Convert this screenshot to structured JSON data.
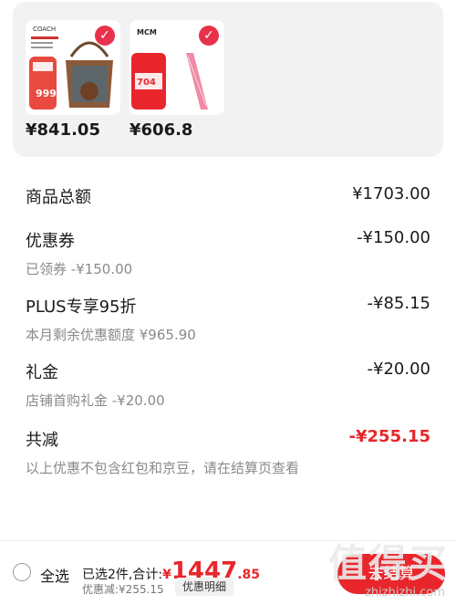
{
  "products": [
    {
      "brand": "COACH",
      "price": "¥841.05",
      "badge": "999"
    },
    {
      "brand": "MCM",
      "price": "¥606.8",
      "badge": "704"
    }
  ],
  "summary": {
    "total_label": "商品总额",
    "total_value": "¥1703.00",
    "coupon_label": "优惠券",
    "coupon_value": "-¥150.00",
    "coupon_sub": "已领券 -¥150.00",
    "plus_label": "PLUS专享95折",
    "plus_value": "-¥85.15",
    "plus_sub": "本月剩余优惠额度 ¥965.90",
    "gift_label": "礼金",
    "gift_value": "-¥20.00",
    "gift_sub": "店铺首购礼金 -¥20.00",
    "reduce_label": "共减",
    "reduce_value": "-¥255.15",
    "note": "以上优惠不包含红包和京豆，请在结算页查看"
  },
  "bottom": {
    "select_all": "全选",
    "selected_text": "已选2件,合计:",
    "currency": "¥",
    "total_int": "1447",
    "total_dec": ".85",
    "saved_text": "优惠减:¥255.15",
    "detail_button": "优惠明细",
    "checkout_button": "去结算"
  },
  "watermark": {
    "text": "值得买",
    "url": "zhizhizhi.com"
  },
  "colors": {
    "accent": "#e8262c",
    "panel": "#f2f2f2",
    "muted": "#8a8a8a"
  }
}
